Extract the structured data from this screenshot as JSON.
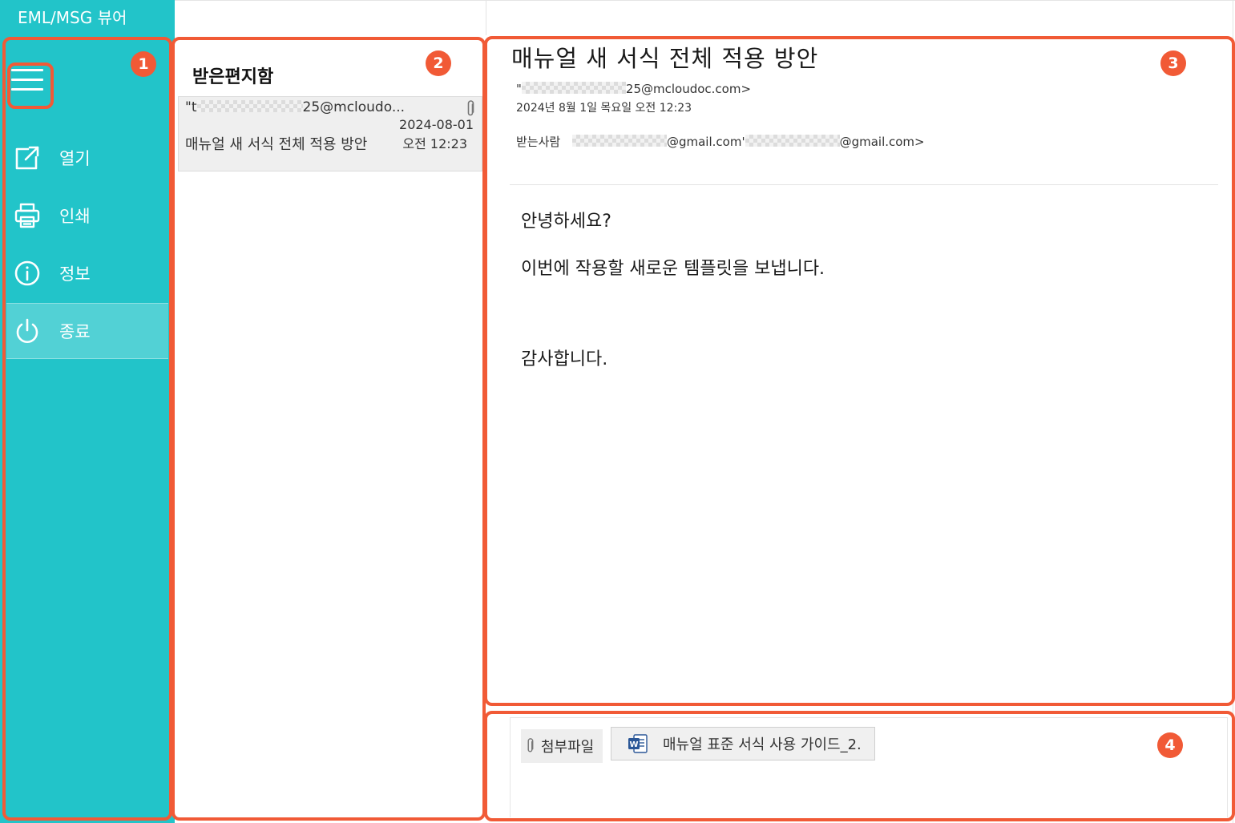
{
  "app": {
    "title": "EML/MSG 뷰어"
  },
  "sidebar": {
    "items": [
      {
        "label": "열기",
        "icon": "open-external-icon"
      },
      {
        "label": "인쇄",
        "icon": "printer-icon"
      },
      {
        "label": "정보",
        "icon": "info-icon"
      },
      {
        "label": "종료",
        "icon": "power-icon",
        "selected": true
      }
    ]
  },
  "inbox": {
    "title": "받은편지함",
    "messages": [
      {
        "from_prefix": "\"t",
        "from_suffix": "25@mcloudo...",
        "subject": "매뉴얼 새 서식 전체 적용 방안",
        "date": "2024-08-01",
        "time": "오전 12:23",
        "has_attachment": true
      }
    ]
  },
  "mail": {
    "subject": "매뉴얼 새 서식 전체 적용 방안",
    "from_prefix": "\"",
    "from_suffix": "25@mcloudoc.com>",
    "date": "2024년 8월 1일 목요일 오전 12:23",
    "to_label": "받는사람",
    "to_1_suffix": "@gmail.com'",
    "to_2_suffix": "@gmail.com>",
    "body": {
      "line1": "안녕하세요?",
      "line2": "이번에 작용할 새로운 템플릿을 보냅니다.",
      "line3": "감사합니다."
    }
  },
  "attachments": {
    "label": "첨부파일",
    "files": [
      {
        "name": "매뉴얼 표준 서식 사용 가이드_2."
      }
    ]
  },
  "annotations": [
    "1",
    "2",
    "3",
    "4"
  ],
  "colors": {
    "sidebar": "#22c4c9",
    "callout": "#f15a36",
    "word": "#2b5797"
  }
}
